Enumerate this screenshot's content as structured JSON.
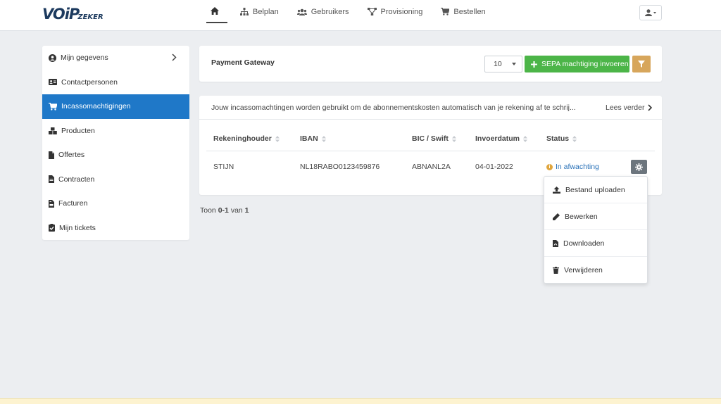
{
  "brand": {
    "logo_main": "VOiP",
    "logo_sub": "ZEKER"
  },
  "nav": {
    "home_icon": "home-icon",
    "items": [
      {
        "label": "Belplan",
        "icon": "sitemap-icon"
      },
      {
        "label": "Gebruikers",
        "icon": "users-icon"
      },
      {
        "label": "Provisioning",
        "icon": "network-icon"
      },
      {
        "label": "Bestellen",
        "icon": "cart-icon"
      }
    ]
  },
  "sidebar": {
    "items": [
      {
        "label": "Mijn gegevens",
        "icon": "user-circle-icon",
        "has_chevron": true
      },
      {
        "label": "Contactpersonen",
        "icon": "address-card-icon"
      },
      {
        "label": "Incassomachtigingen",
        "icon": "cart-icon",
        "active": true
      },
      {
        "label": "Producten",
        "icon": "boxes-icon"
      },
      {
        "label": "Offertes",
        "icon": "file-icon"
      },
      {
        "label": "Contracten",
        "icon": "file-contract-icon"
      },
      {
        "label": "Facturen",
        "icon": "file-invoice-icon"
      },
      {
        "label": "Mijn tickets",
        "icon": "clipboard-check-icon"
      }
    ]
  },
  "header_card": {
    "title": "Payment Gateway",
    "page_size": "10",
    "add_button": "SEPA machtiging invoeren",
    "filter_icon": "filter-icon"
  },
  "info": {
    "text": "Jouw incassomachtingen worden gebruikt om de abonnementskosten automatisch van je rekening af te schrij...",
    "read_more": "Lees verder"
  },
  "table": {
    "columns": [
      "Rekeninghouder",
      "IBAN",
      "BIC / Swift",
      "Invoerdatum",
      "Status"
    ],
    "rows": [
      {
        "holder": "STIJN",
        "iban": "NL18RABO0123459876",
        "bic": "ABNANL2A",
        "date": "04-01-2022",
        "status": "In afwachting"
      }
    ]
  },
  "pagination": {
    "prefix": "Toon",
    "range": "0-1",
    "middle": "van",
    "total": "1"
  },
  "actions_menu": [
    {
      "label": "Bestand uploaden",
      "icon": "upload-icon"
    },
    {
      "label": "Bewerken",
      "icon": "pencil-icon"
    },
    {
      "label": "Downloaden",
      "icon": "pdf-file-icon"
    },
    {
      "label": "Verwijderen",
      "icon": "trash-icon"
    }
  ],
  "colors": {
    "primary": "#1f78c8",
    "success": "#4cb548",
    "warning": "#d7a65c",
    "status_pending": "#e0a63e",
    "link": "#2a72b8"
  }
}
